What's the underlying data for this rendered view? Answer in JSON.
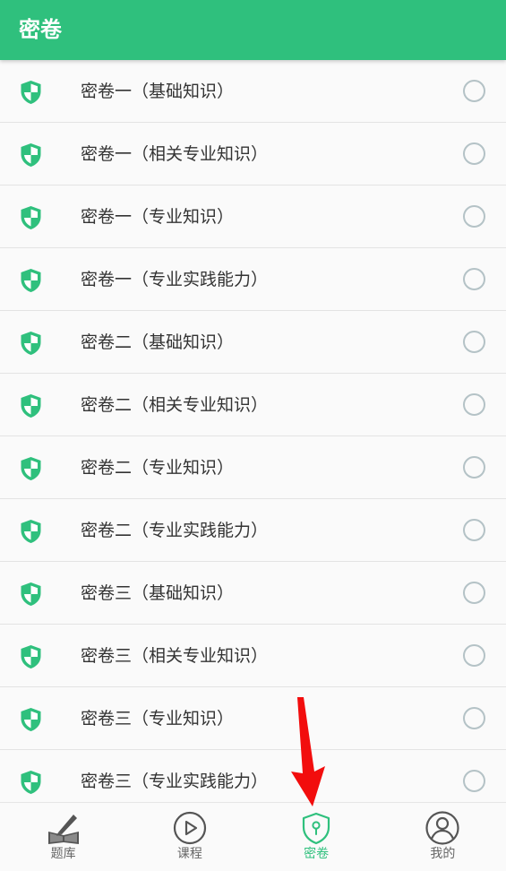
{
  "header": {
    "title": "密卷"
  },
  "colors": {
    "accent": "#2fc07d",
    "radio_border": "#b4c2c6",
    "annotation_arrow": "#f20d0d"
  },
  "list": {
    "items": [
      {
        "label": "密卷一（基础知识）",
        "selected": false
      },
      {
        "label": "密卷一（相关专业知识）",
        "selected": false
      },
      {
        "label": "密卷一（专业知识）",
        "selected": false
      },
      {
        "label": "密卷一（专业实践能力）",
        "selected": false
      },
      {
        "label": "密卷二（基础知识）",
        "selected": false
      },
      {
        "label": "密卷二（相关专业知识）",
        "selected": false
      },
      {
        "label": "密卷二（专业知识）",
        "selected": false
      },
      {
        "label": "密卷二（专业实践能力）",
        "selected": false
      },
      {
        "label": "密卷三（基础知识）",
        "selected": false
      },
      {
        "label": "密卷三（相关专业知识）",
        "selected": false
      },
      {
        "label": "密卷三（专业知识）",
        "selected": false
      },
      {
        "label": "密卷三（专业实践能力）",
        "selected": false
      }
    ]
  },
  "bottom_nav": {
    "active": "secret",
    "items": [
      {
        "id": "question-bank",
        "label": "题库",
        "icon": "book-pen-icon"
      },
      {
        "id": "courses",
        "label": "课程",
        "icon": "play-circle-icon"
      },
      {
        "id": "secret",
        "label": "密卷",
        "icon": "shield-lock-icon"
      },
      {
        "id": "mine",
        "label": "我的",
        "icon": "user-circle-icon"
      }
    ]
  }
}
